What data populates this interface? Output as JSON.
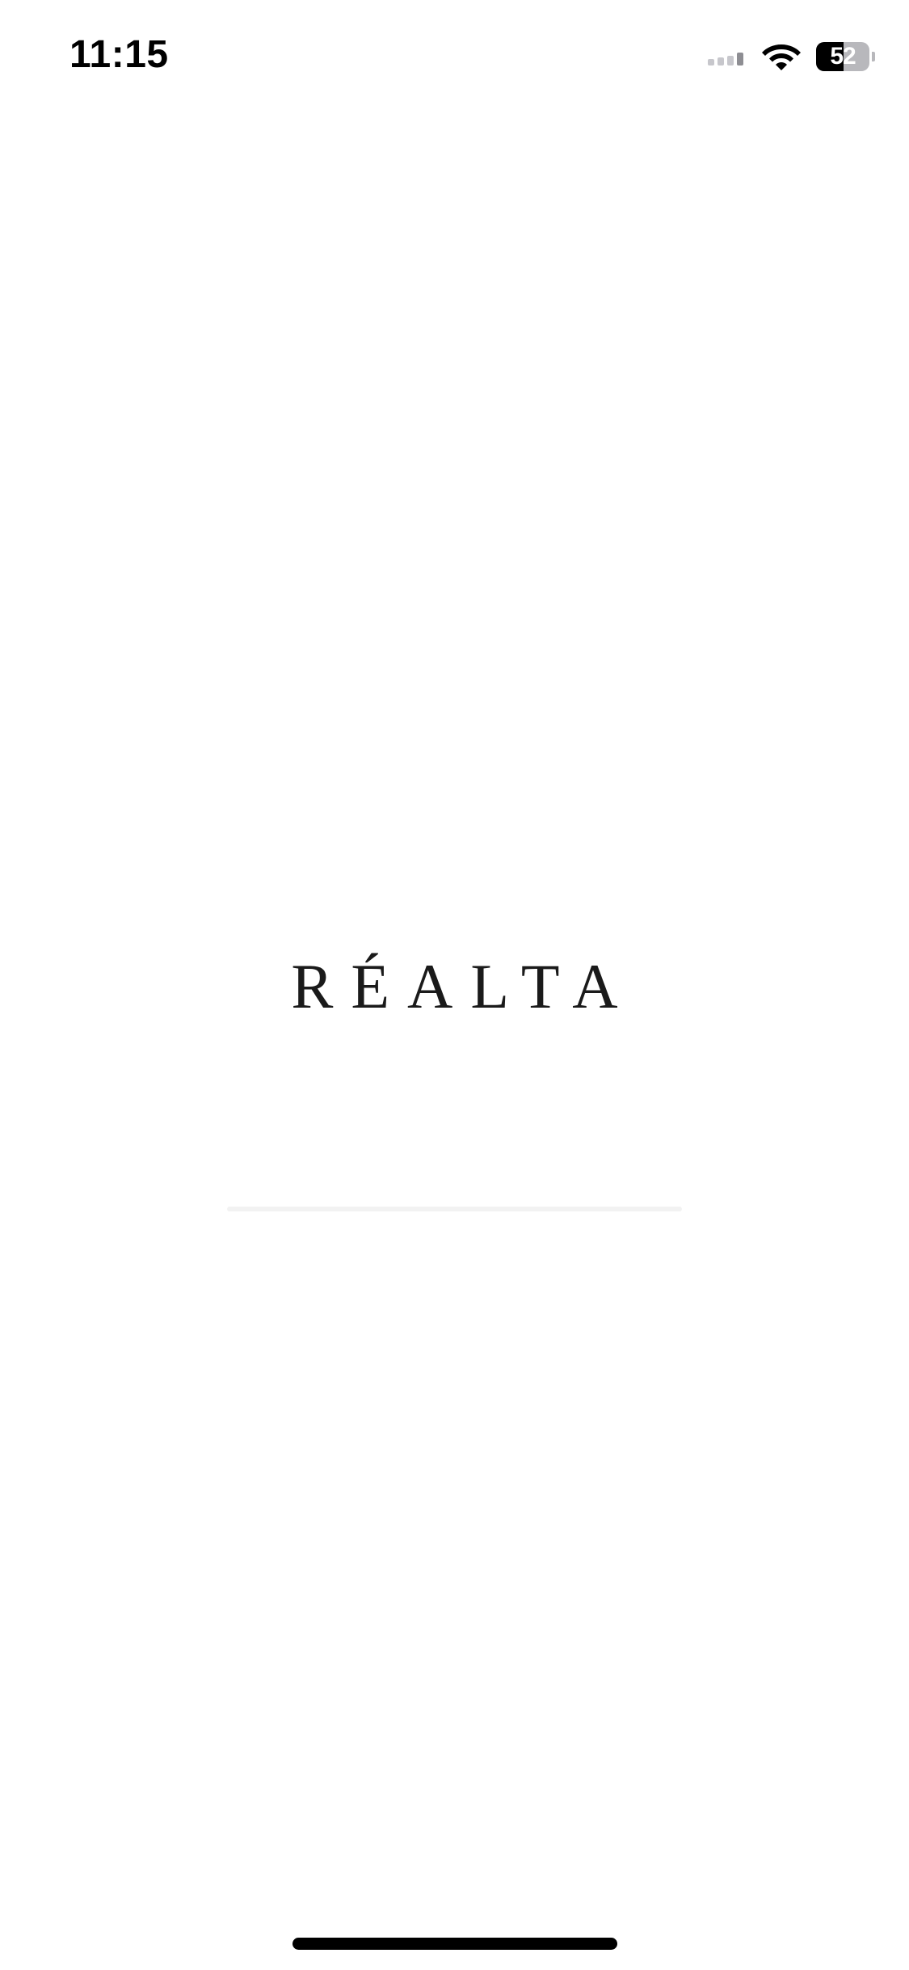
{
  "status_bar": {
    "time": "11:15",
    "battery_level": "52",
    "battery_fraction": 0.52,
    "signal_icon": "cellular-signal-icon",
    "wifi_icon": "wifi-icon",
    "battery_icon": "battery-icon"
  },
  "splash": {
    "brand_name": "RÉALTA",
    "loading_progress": 0
  },
  "colors": {
    "background": "#ffffff",
    "text": "#1a1a1a",
    "status_text": "#000000",
    "loading_track": "#f2f2f2"
  }
}
